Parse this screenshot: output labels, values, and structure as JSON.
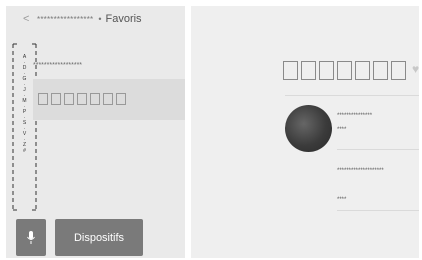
{
  "header": {
    "back_glyph": "<",
    "crumb_stars": "*****************",
    "crumb_sep": "•",
    "crumb_fav": "Favoris"
  },
  "index": {
    "letters": [
      "A",
      "·",
      "D",
      "·",
      "G",
      "·",
      "J",
      "·",
      "M",
      "·",
      "P",
      "·",
      "S",
      "·",
      "V",
      "·",
      "Z",
      "#"
    ]
  },
  "list": {
    "row1": "******************",
    "row2_boxes": 7
  },
  "bottom": {
    "mic_icon": "microphone-icon",
    "devices_label": "Dispositifs"
  },
  "detail": {
    "title_boxes": 7,
    "heart_icon": "heart-icon",
    "contact1_line1": "***************",
    "contact1_line2": "****",
    "contact2_line1": "********************",
    "contact2_line2": "****"
  }
}
